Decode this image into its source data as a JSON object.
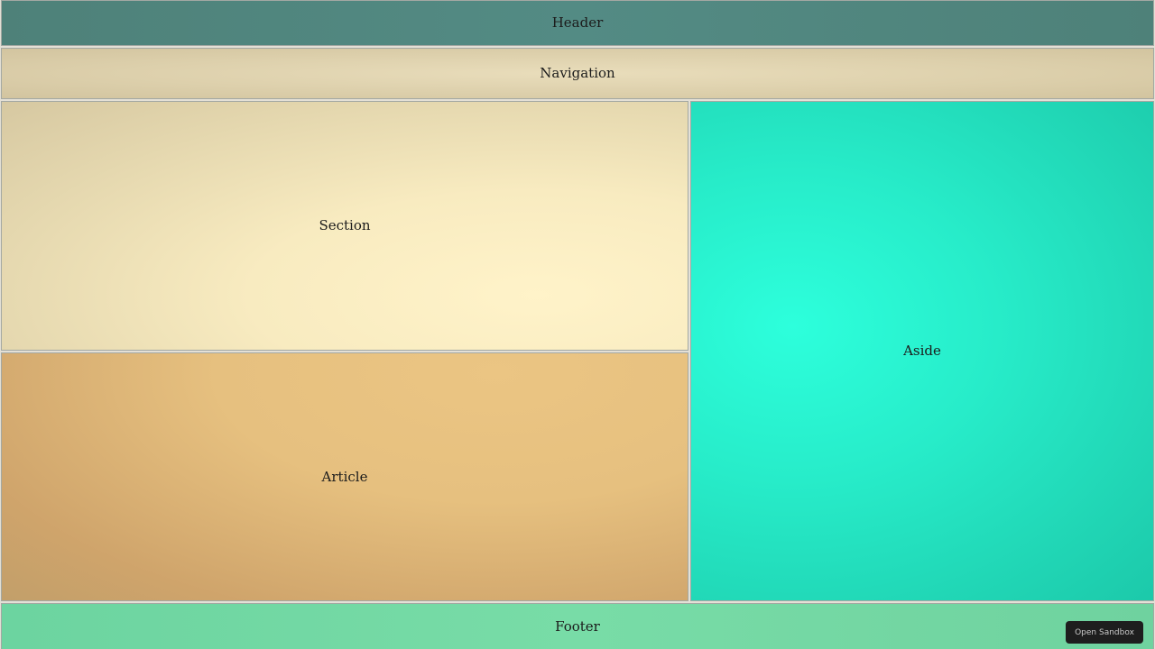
{
  "layout": {
    "header_label": "Header",
    "navigation_label": "Navigation",
    "section_label": "Section",
    "article_label": "Article",
    "aside_label": "Aside",
    "footer_label": "Footer"
  },
  "actions": {
    "open_sandbox_label": "Open Sandbox"
  },
  "colors": {
    "header": "#538b84",
    "navigation": "#ddd0ac",
    "section": "#f8ebc0",
    "article": "#e6c07f",
    "aside": "#27ecc9",
    "footer": "#78dca7",
    "sandbox_button": "#1e1e1e"
  }
}
